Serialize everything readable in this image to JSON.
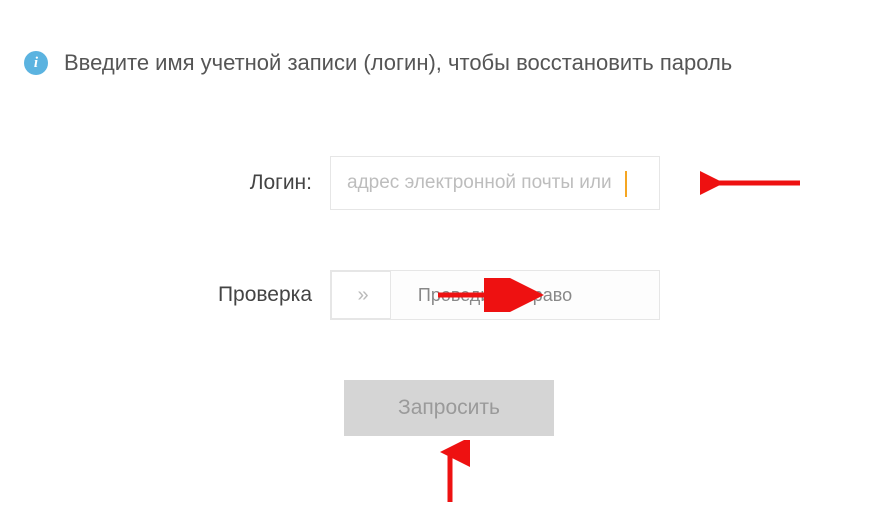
{
  "info": {
    "text": "Введите имя учетной записи (логин), чтобы восстановить пароль"
  },
  "form": {
    "login": {
      "label": "Логин:",
      "placeholder": "адрес электронной почты или"
    },
    "verify": {
      "label": "Проверка",
      "slider_text": "Проведите вправо",
      "slider_handle": "»"
    },
    "submit": {
      "label": "Запросить"
    }
  }
}
